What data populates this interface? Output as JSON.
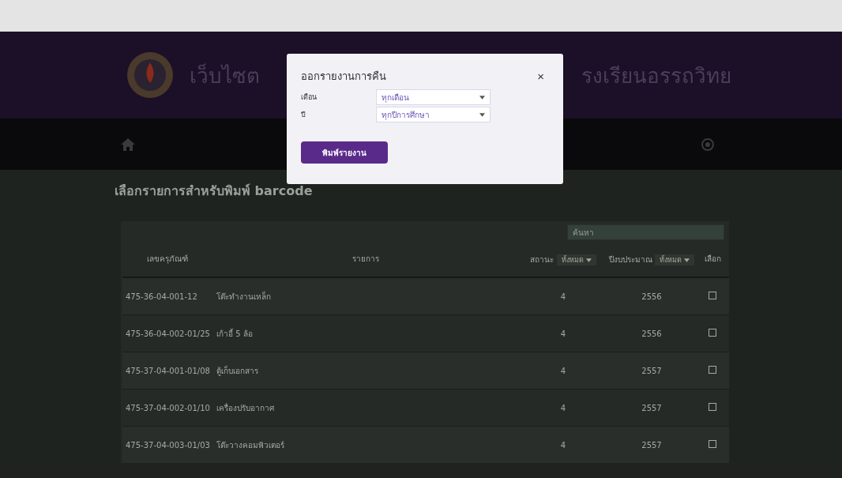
{
  "header": {
    "title_left": "เว็บไซต",
    "title_right": "รงเรียนอรรถวิทย"
  },
  "page_heading": "เลือกรายการสำหรับพิมพ์ barcode",
  "search": {
    "placeholder": "ค้นหา"
  },
  "table": {
    "columns": [
      {
        "label": "เลขครุภัณฑ์"
      },
      {
        "label": "รายการ"
      },
      {
        "label": "สถานะ",
        "filter": "ทั้งหมด"
      },
      {
        "label": "ปีงบประมาณ",
        "filter": "ทั้งหมด"
      },
      {
        "label": "เลือก"
      }
    ],
    "rows": [
      {
        "code": "475-36-04-001-12",
        "name": "โต๊ะทำงานเหล็ก",
        "status": "4",
        "year": "2556",
        "checked": false
      },
      {
        "code": "475-36-04-002-01/25",
        "name": "เก้าอี้ 5 ล้อ",
        "status": "4",
        "year": "2556",
        "checked": false
      },
      {
        "code": "475-37-04-001-01/08",
        "name": "ตู้เก็บเอกสาร",
        "status": "4",
        "year": "2557",
        "checked": false
      },
      {
        "code": "475-37-04-002-01/10",
        "name": "เครื่องปรับอากาศ",
        "status": "4",
        "year": "2557",
        "checked": false
      },
      {
        "code": "475-37-04-003-01/03",
        "name": "โต๊ะวางคอมพิวเตอร์",
        "status": "4",
        "year": "2557",
        "checked": false
      }
    ]
  },
  "modal": {
    "title": "ออกรายงานการคืน",
    "close": "×",
    "fields": [
      {
        "label": "เดือน",
        "value": "ทุกเดือน"
      },
      {
        "label": "ปี",
        "value": "ทุกปีการศึกษา"
      }
    ],
    "button": "พิมพ์รายงาน"
  }
}
